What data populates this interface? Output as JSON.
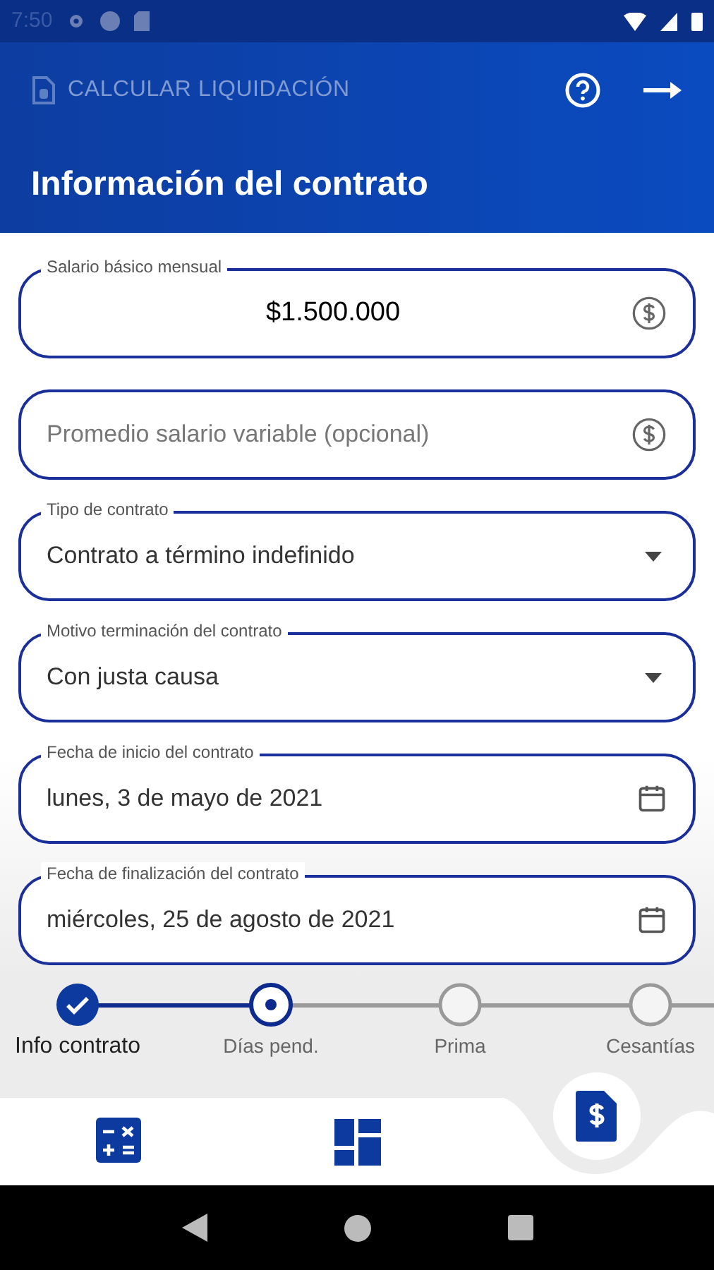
{
  "status_bar": {
    "time": "7:50"
  },
  "app_bar": {
    "title": "CALCULAR LIQUIDACIÓN"
  },
  "page_title": "Información del contrato",
  "fields": [
    {
      "kind": "money",
      "label": "Salario básico mensual",
      "value": "$1.500.000"
    },
    {
      "kind": "money",
      "placeholder": "Promedio salario variable (opcional)"
    },
    {
      "kind": "select",
      "label": "Tipo de contrato",
      "value": "Contrato a término indefinido"
    },
    {
      "kind": "select",
      "label": "Motivo terminación del contrato",
      "value": "Con justa causa"
    },
    {
      "kind": "date",
      "label": "Fecha de inicio del contrato",
      "value": "lunes, 3 de mayo de 2021"
    },
    {
      "kind": "date",
      "label": "Fecha de finalización del contrato",
      "value": "miércoles, 25 de agosto de 2021"
    }
  ],
  "steps": [
    {
      "label": "Info contrato",
      "kind": "done"
    },
    {
      "label": "Días pend.",
      "kind": "current"
    },
    {
      "label": "Prima",
      "kind": "pending"
    },
    {
      "label": "Cesantías",
      "kind": "pending"
    }
  ]
}
